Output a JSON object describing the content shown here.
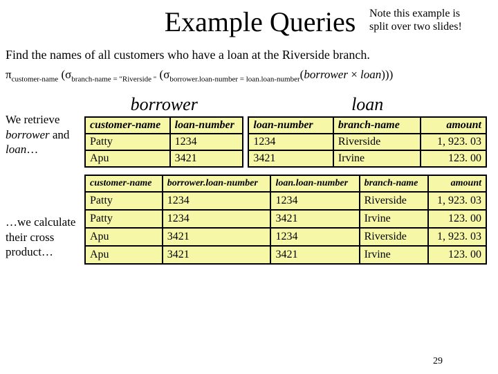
{
  "header": {
    "title": "Example Queries",
    "note_line1": "Note this example is",
    "note_line2": "split over two slides!"
  },
  "prompt": "Find the names of all customers who have a loan at the Riverside branch.",
  "formula": {
    "proj_sub": "customer-name",
    "sel1_sub": "branch-name = \"Riverside \"",
    "sel2_sub": "borrower.loan-number = loan.loan-number",
    "rel1": "borrower",
    "rel2": "loan"
  },
  "side1_a": "We retrieve",
  "side1_b": "borrower",
  "side1_c": " and ",
  "side1_d": "loan",
  "side1_e": "…",
  "side2_a": "…we calculate",
  "side2_b": "their cross",
  "side2_c": "product…",
  "borrower": {
    "heading": "borrower",
    "h1": "customer-name",
    "h2": "loan-number",
    "r1c1": "Patty",
    "r1c2": "1234",
    "r2c1": "Apu",
    "r2c2": "3421"
  },
  "loan": {
    "heading": "loan",
    "h1": "loan-number",
    "h2": "branch-name",
    "h3": "amount",
    "r1c1": "1234",
    "r1c2": "Riverside",
    "r1c3": "1, 923. 03",
    "r2c1": "3421",
    "r2c2": "Irvine",
    "r2c3": "123. 00"
  },
  "cross": {
    "h1": "customer-name",
    "h2": "borrower.loan-number",
    "h3": "loan.loan-number",
    "h4": "branch-name",
    "h5": "amount",
    "r1": {
      "c1": "Patty",
      "c2": "1234",
      "c3": "1234",
      "c4": "Riverside",
      "c5": "1, 923. 03"
    },
    "r2": {
      "c1": "Patty",
      "c2": "1234",
      "c3": "3421",
      "c4": "Irvine",
      "c5": "123. 00"
    },
    "r3": {
      "c1": "Apu",
      "c2": "3421",
      "c3": "1234",
      "c4": "Riverside",
      "c5": "1, 923. 03"
    },
    "r4": {
      "c1": "Apu",
      "c2": "3421",
      "c3": "3421",
      "c4": "Irvine",
      "c5": "123. 00"
    }
  },
  "pagenum": "29"
}
